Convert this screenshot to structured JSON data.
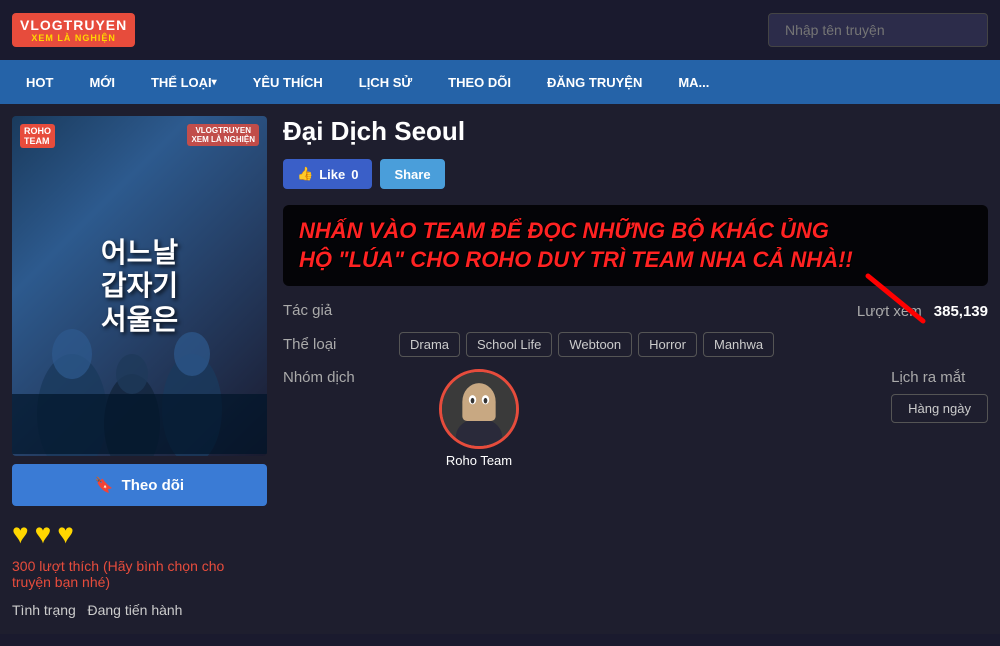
{
  "header": {
    "logo_main": "VLOGTRUYEN",
    "logo_sub": "XEM LÀ NGHIỆN",
    "search_placeholder": "Nhập tên truyện"
  },
  "nav": {
    "items": [
      {
        "label": "HOT",
        "has_arrow": false
      },
      {
        "label": "MỚI",
        "has_arrow": false
      },
      {
        "label": "THỂ LOẠI",
        "has_arrow": true
      },
      {
        "label": "YÊU THÍCH",
        "has_arrow": false
      },
      {
        "label": "LỊCH SỬ",
        "has_arrow": false
      },
      {
        "label": "THEO DÕI",
        "has_arrow": false
      },
      {
        "label": "ĐĂNG TRUYỆN",
        "has_arrow": false
      },
      {
        "label": "MA...",
        "has_arrow": false
      }
    ]
  },
  "manga": {
    "title": "Đại Dịch Seoul",
    "like_label": "Like",
    "like_count": "0",
    "share_label": "Share",
    "promo_line1": "NHẤN VÀO TEAM ĐỂ ĐỌC NHỮNG BỘ KHÁC ỦNG",
    "promo_line2": "HỘ \"LÚA\" CHO ROHO DUY TRÌ TEAM NHA CẢ NHÀ!!",
    "tac_gia_label": "Tác giả",
    "tac_gia_value": "",
    "luot_xem_label": "Lượt xem",
    "luot_xem_value": "385,139",
    "the_loai_label": "Thể loại",
    "tags": [
      "Drama",
      "School Life",
      "Webtoon",
      "Horror",
      "Manhwa"
    ],
    "nhom_dich_label": "Nhóm dịch",
    "translator_name": "Roho Team",
    "lich_ra_mat_label": "Lịch ra mắt",
    "lich_ra_mat_value": "Hàng ngày",
    "follow_label": "Theo dõi",
    "stars_count": 3,
    "likes_count": "300",
    "likes_text": "lượt thích",
    "rating_action": "(Hãy bình chọn cho truyện bạn nhé)",
    "tinh_trang_label": "Tình trạng",
    "tinh_trang_value": "Đang tiến hành",
    "cover_text_line1": "어느날",
    "cover_text_line2": "갑자기",
    "cover_text_line3": "서울은",
    "roho_badge": "ROHO\nTEAM"
  }
}
